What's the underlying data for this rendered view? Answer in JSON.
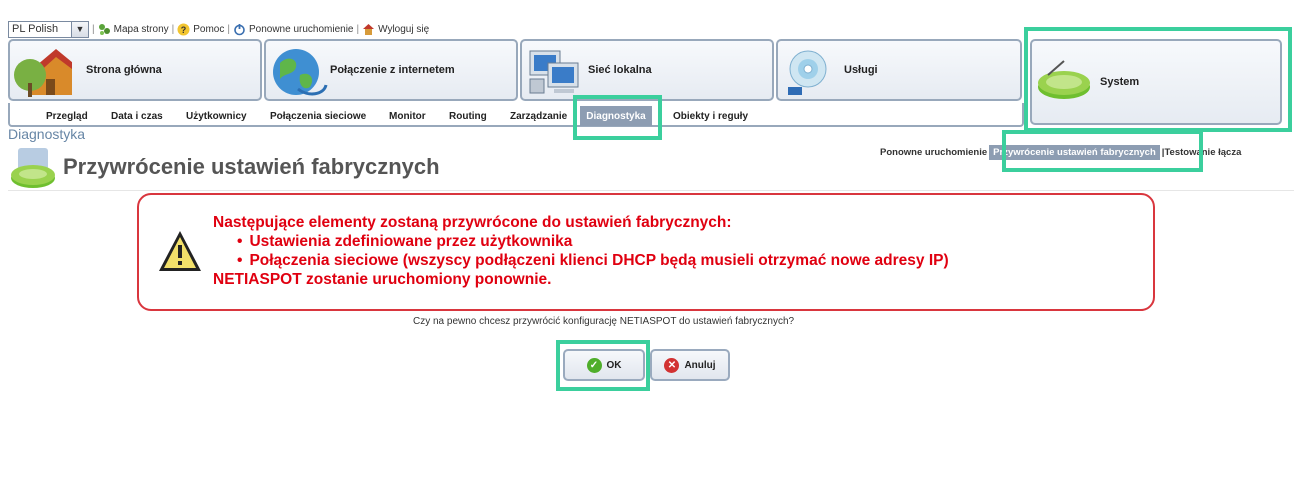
{
  "topbar": {
    "language": "PL Polish",
    "links": [
      "Mapa strony",
      "Pomoc",
      "Ponowne uruchomienie",
      "Wyloguj się"
    ]
  },
  "tabs": [
    {
      "label": "Strona główna",
      "icon": "home-icon"
    },
    {
      "label": "Połączenie z internetem",
      "icon": "globe-icon"
    },
    {
      "label": "Sieć lokalna",
      "icon": "computers-icon"
    },
    {
      "label": "Usługi",
      "icon": "services-icon"
    },
    {
      "label": "System",
      "icon": "system-router-icon"
    }
  ],
  "subnav": [
    "Przegląd",
    "Data i czas",
    "Użytkownicy",
    "Połączenia sieciowe",
    "Monitor",
    "Routing",
    "Zarządzanie",
    "Diagnostyka",
    "Obiekty i reguły"
  ],
  "page": {
    "section": "Diagnostyka",
    "title": "Przywrócenie ustawień fabrycznych"
  },
  "breadcrumbs": {
    "left": "Ponowne uruchomienie",
    "active": "Przywrócenie ustawień fabrycznych",
    "right": "Testowanie łącza"
  },
  "warning": {
    "line1": "Następujące elementy zostaną przywrócone do ustawień fabrycznych:",
    "bullets": [
      "Ustawienia zdefiniowane przez użytkownika",
      "Połączenia sieciowe (wszyscy podłączeni klienci DHCP będą musieli otrzymać nowe adresy IP)"
    ],
    "line4": "NETIASPOT zostanie uruchomiony ponownie."
  },
  "question": "Czy na pewno chcesz przywrócić konfigurację NETIASPOT do ustawień fabrycznych?",
  "buttons": {
    "ok": "OK",
    "cancel": "Anuluj"
  },
  "colors": {
    "highlight": "#3bcf9d",
    "warning": "#e00010",
    "accent": "#8d9db2"
  }
}
